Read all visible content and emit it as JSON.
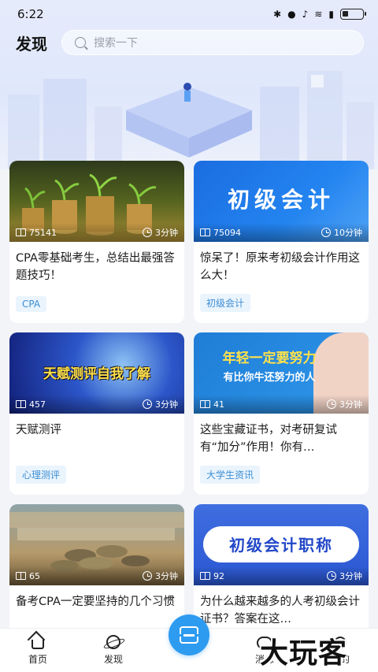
{
  "status_bar": {
    "time": "6:22",
    "icons": [
      "bluetooth-icon",
      "location-icon",
      "mute-icon",
      "wifi-icon",
      "sim-icon",
      "battery-icon"
    ]
  },
  "header": {
    "title": "发现",
    "search_placeholder": "搜索一下"
  },
  "cards": [
    {
      "views": "75141",
      "duration": "3分钟",
      "title": "CPA零基础考生，总结出最强答题技巧！",
      "tag": "CPA",
      "thumb_text": ""
    },
    {
      "views": "75094",
      "duration": "10分钟",
      "title": "惊呆了！原来考初级会计作用这么大！",
      "tag": "初级会计",
      "thumb_text": "初级会计"
    },
    {
      "views": "457",
      "duration": "3分钟",
      "title": "天赋测评",
      "tag": "心理测评",
      "thumb_text": "天赋测评自我了解"
    },
    {
      "views": "41",
      "duration": "3分钟",
      "title": "这些宝藏证书，对考研复试有“加分”作用！你有…",
      "tag": "大学生资讯",
      "thumb_text": "年轻一定要努力",
      "thumb_text2": "有比你牛还努力的人"
    },
    {
      "views": "65",
      "duration": "3分钟",
      "title": "备考CPA一定要坚持的几个习惯",
      "tag": "",
      "thumb_text": ""
    },
    {
      "views": "92",
      "duration": "3分钟",
      "title": "为什么越来越多的人考初级会计证书？答案在这…",
      "tag": "",
      "thumb_text": "初级会计职称"
    }
  ],
  "bottom_nav": {
    "home": "首页",
    "discover": "发现",
    "messages": "消息",
    "me": "我的"
  },
  "watermark": "大玩客"
}
